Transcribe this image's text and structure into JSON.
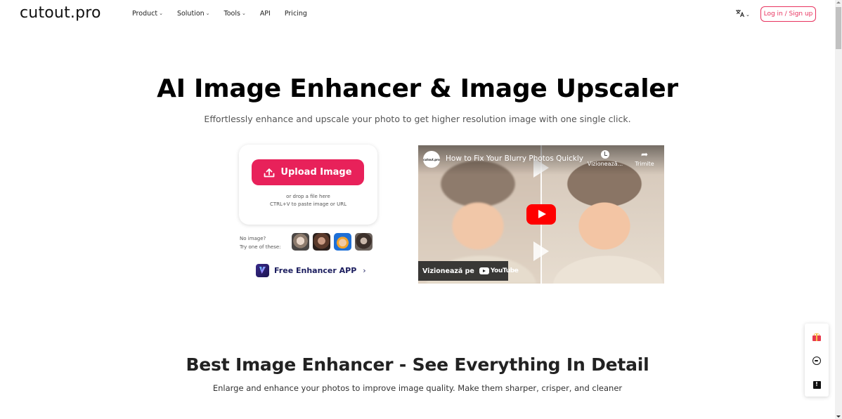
{
  "header": {
    "logo": "cutout.pro",
    "nav": [
      {
        "label": "Product",
        "has_dropdown": true
      },
      {
        "label": "Solution",
        "has_dropdown": true
      },
      {
        "label": "Tools",
        "has_dropdown": true
      },
      {
        "label": "API",
        "has_dropdown": false
      },
      {
        "label": "Pricing",
        "has_dropdown": false
      }
    ],
    "language_icon": "translate-icon",
    "chevron": "⌄",
    "login_label": "Log in / Sign up"
  },
  "hero": {
    "title": "AI Image Enhancer & Image Upscaler",
    "subtitle": "Effortlessly enhance and upscale your photo to get higher resolution image with one single click."
  },
  "upload": {
    "button_label": "Upload Image",
    "hint_line1": "or drop a file here",
    "hint_line2": "CTRL+V to paste image or URL",
    "samples_line1": "No image?",
    "samples_line2": "Try one of these:",
    "sample_count": 4,
    "app_link_label": "Free Enhancer APP",
    "app_link_chevron": "›"
  },
  "video": {
    "channel_logo_text": "cutout.pro",
    "title": "How to Fix Your Blurry Photos Quickly",
    "watch_later_label": "Vizionează...",
    "share_label": "Trimite",
    "share_glyph": "➦",
    "watch_on_label": "Vizionează pe",
    "youtube_word": "YouTube"
  },
  "section2": {
    "title": "Best Image Enhancer - See Everything In Detail",
    "subtitle": "Enlarge and enhance your photos to improve image quality. Make them sharper, crisper, and cleaner"
  },
  "floating_toolbar": {
    "items": [
      "gift-icon",
      "support-icon",
      "feedback-icon"
    ],
    "feedback_glyph": "!"
  },
  "colors": {
    "accent": "#e8215a",
    "login_border": "#e8335f",
    "app_link": "#1b1d5e",
    "youtube_red": "#ff0000"
  }
}
